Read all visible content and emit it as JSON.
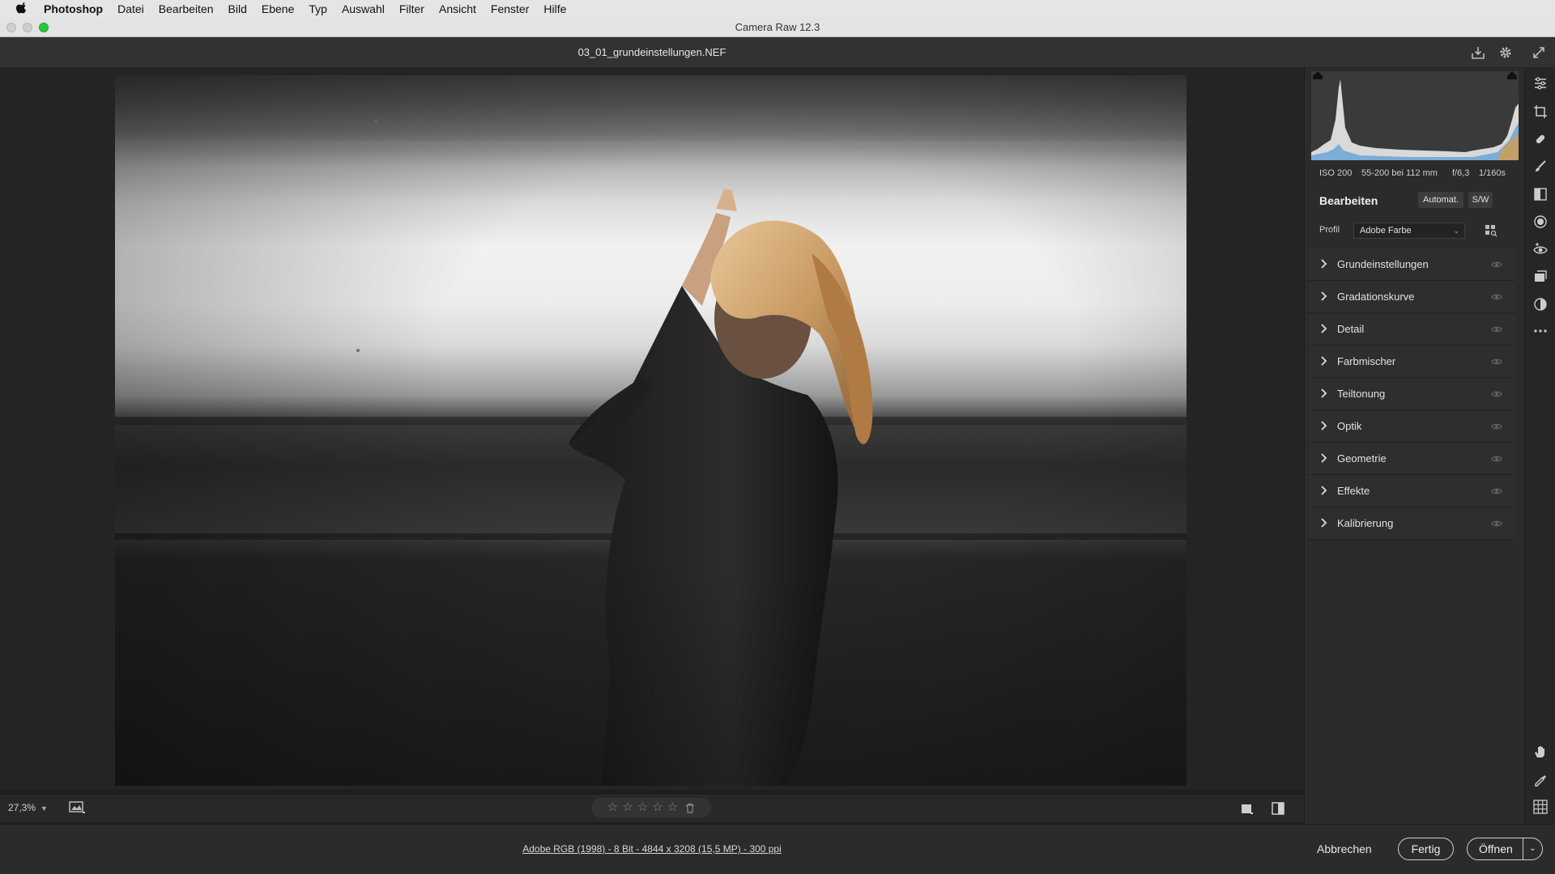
{
  "menubar": {
    "app": "Photoshop",
    "items": [
      "Datei",
      "Bearbeiten",
      "Bild",
      "Ebene",
      "Typ",
      "Auswahl",
      "Filter",
      "Ansicht",
      "Fenster",
      "Hilfe"
    ]
  },
  "window": {
    "title": "Camera Raw 12.3"
  },
  "file": {
    "name": "03_01_grundeinstellungen.NEF"
  },
  "canvas": {
    "zoom": "27,3%",
    "rating_stars": 5,
    "rating_value": 0
  },
  "info": {
    "iso": "ISO 200",
    "lens": "55-200 bei 112 mm",
    "aperture": "f/6,3",
    "shutter": "1/160s"
  },
  "edit": {
    "title": "Bearbeiten",
    "auto_label": "Automat.",
    "bw_label": "S/W",
    "profile_label": "Profil",
    "profile_value": "Adobe Farbe"
  },
  "sections": [
    {
      "label": "Grundeinstellungen"
    },
    {
      "label": "Gradationskurve"
    },
    {
      "label": "Detail"
    },
    {
      "label": "Farbmischer"
    },
    {
      "label": "Teiltonung"
    },
    {
      "label": "Optik"
    },
    {
      "label": "Geometrie"
    },
    {
      "label": "Effekte"
    },
    {
      "label": "Kalibrierung"
    }
  ],
  "workflow": "Adobe RGB (1998) - 8 Bit - 4844 x 3208 (15,5 MP) - 300 ppi",
  "buttons": {
    "cancel": "Abbrechen",
    "done": "Fertig",
    "open": "Öffnen"
  },
  "colors": {
    "panel": "#2b2b2b",
    "canvas": "#242424",
    "accent_green": "#2ac43f"
  },
  "icons": [
    "apple-icon",
    "save-icon",
    "gear-icon",
    "fullscreen-icon",
    "edit-sliders-icon",
    "crop-icon",
    "heal-icon",
    "brush-icon",
    "gradient-icon",
    "radial-icon",
    "redeye-icon",
    "snapshot-icon",
    "presets-icon",
    "more-icon",
    "hand-icon",
    "color-sampler-icon",
    "grid-icon"
  ]
}
